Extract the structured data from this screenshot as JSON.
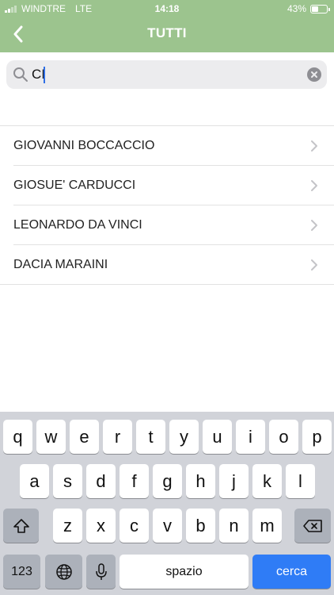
{
  "status_bar": {
    "carrier": "WINDTRE",
    "network": "LTE",
    "time": "14:18",
    "battery": "43%",
    "battery_level": 0.43
  },
  "nav": {
    "title": "TUTTI",
    "back_icon": "chevron-left-icon"
  },
  "search": {
    "value": "CI",
    "placeholder": "",
    "search_icon": "search-icon",
    "clear_icon": "clear-icon"
  },
  "results": [
    {
      "label": "GIOVANNI BOCCACCIO"
    },
    {
      "label": "GIOSUE' CARDUCCI"
    },
    {
      "label": "LEONARDO DA VINCI"
    },
    {
      "label": "DACIA MARAINI"
    }
  ],
  "keyboard": {
    "row1": [
      "q",
      "w",
      "e",
      "r",
      "t",
      "y",
      "u",
      "i",
      "o",
      "p"
    ],
    "row2": [
      "a",
      "s",
      "d",
      "f",
      "g",
      "h",
      "j",
      "k",
      "l"
    ],
    "row3": [
      "z",
      "x",
      "c",
      "v",
      "b",
      "n",
      "m"
    ],
    "numbers_label": "123",
    "space_label": "spazio",
    "search_label": "cerca"
  },
  "colors": {
    "header": "#9cc48e",
    "accent": "#2f7cf6"
  }
}
